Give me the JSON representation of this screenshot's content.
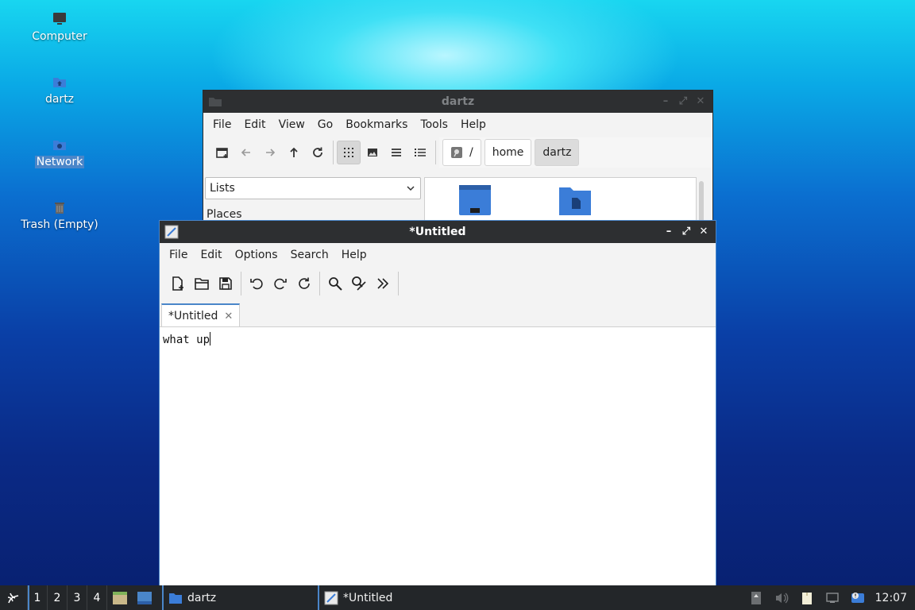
{
  "desktop": {
    "icons": [
      {
        "label": "Computer",
        "icon": "computer-icon"
      },
      {
        "label": "dartz",
        "icon": "home-folder-icon"
      },
      {
        "label": "Network",
        "icon": "network-icon",
        "selected": true
      },
      {
        "label": "Trash (Empty)",
        "icon": "trash-icon"
      }
    ]
  },
  "file_manager": {
    "title": "dartz",
    "menu": [
      "File",
      "Edit",
      "View",
      "Go",
      "Bookmarks",
      "Tools",
      "Help"
    ],
    "toolbar_icons": [
      "new-tab-icon",
      "back-arrow-icon",
      "forward-arrow-icon",
      "up-arrow-icon",
      "reload-icon",
      "icon-view-icon",
      "thumbnail-view-icon",
      "compact-view-icon",
      "detailed-list-view-icon"
    ],
    "path": {
      "root": "/",
      "segments": [
        "home",
        "dartz"
      ]
    },
    "side_pane_select": "Lists",
    "side_pane_heading": "Places"
  },
  "editor": {
    "title": "*Untitled",
    "menu": [
      "File",
      "Edit",
      "Options",
      "Search",
      "Help"
    ],
    "toolbar_icons": [
      "new-document-icon",
      "open-folder-icon",
      "save-icon",
      "undo-icon",
      "redo-icon",
      "reload-icon",
      "find-icon",
      "find-replace-icon",
      "go-to-line-icon"
    ],
    "tab_label": "*Untitled",
    "content": "what up"
  },
  "taskbar": {
    "workspaces": [
      "1",
      "2",
      "3",
      "4"
    ],
    "tasks": [
      {
        "label": "dartz",
        "icon": "folder-icon"
      },
      {
        "label": "*Untitled",
        "icon": "text-editor-icon"
      }
    ],
    "clock": "12:07"
  },
  "colors": {
    "accent": "#4a86c9",
    "titlebar": "#2d2f31",
    "taskbar": "#232629",
    "folder_blue": "#3b7dd8"
  }
}
